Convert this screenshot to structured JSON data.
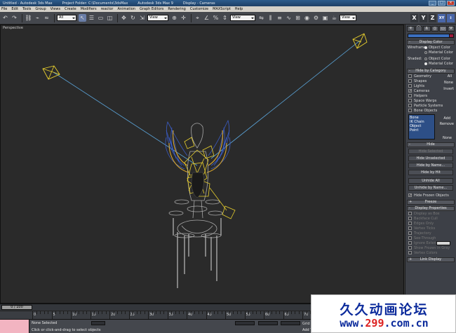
{
  "titlebar": {
    "segments": [
      "Untitled - Autodesk 3ds Max",
      "Project Folder: C:\\Documents\\3dsMax",
      "Autodesk 3ds Max 9",
      "Display - Cameras"
    ],
    "min": "_",
    "max": "□",
    "close": "×"
  },
  "menubar": [
    "File",
    "Edit",
    "Tools",
    "Group",
    "Views",
    "Create",
    "Modifiers",
    "reactor",
    "Animation",
    "Graph Editors",
    "Rendering",
    "Customize",
    "MAXScript",
    "Help"
  ],
  "toolbar": {
    "selection_filter": "All",
    "ref_coord": "View",
    "named_selection": "View",
    "axes": [
      "X",
      "Y",
      "Z",
      "XY"
    ]
  },
  "viewport": {
    "label": "Perspective",
    "colors": {
      "camera": "#e8cf2e",
      "target_line": "#5aa2d6",
      "wing_blue": "#3b5cc4",
      "wing_gold": "#d8a52a",
      "statue": "#a9a9a9"
    }
  },
  "command_panel": {
    "tabs": [
      "create-icon",
      "modify-icon",
      "hierarchy-icon",
      "motion-icon",
      "display-icon",
      "utilities-icon"
    ],
    "display_color": {
      "title": "Display Color",
      "wireframe_label": "Wireframe:",
      "shaded_label": "Shaded:",
      "object_color": "Object Color",
      "material_color": "Material Color"
    },
    "hide_by_category": {
      "title": "Hide by Category",
      "items": [
        {
          "label": "Geometry",
          "checked": false
        },
        {
          "label": "Shapes",
          "checked": false
        },
        {
          "label": "Lights",
          "checked": false
        },
        {
          "label": "Cameras",
          "checked": true
        },
        {
          "label": "Helpers",
          "checked": false
        },
        {
          "label": "Space Warps",
          "checked": false
        },
        {
          "label": "Particle Systems",
          "checked": false
        },
        {
          "label": "Bone Objects",
          "checked": false
        }
      ],
      "all": "All",
      "none": "None",
      "invert": "Invert",
      "list": [
        "Bone",
        "IK Chain Object",
        "Point"
      ],
      "add": "Add",
      "remove": "Remove",
      "none2": "None"
    },
    "hide": {
      "title": "Hide",
      "hide_selected": "Hide Selected",
      "hide_unselected": "Hide Unselected",
      "hide_by_name": "Hide by Name...",
      "hide_by_hit": "Hide by Hit",
      "unhide_all": "Unhide All",
      "unhide_by_name": "Unhide by Name...",
      "hide_frozen": "Hide Frozen Objects"
    },
    "freeze_title": "Freeze",
    "display_properties": {
      "title": "Display Properties",
      "items": [
        "Display as Box",
        "Backface Cull",
        "Edges Only",
        "Vertex Ticks",
        "Trajectory",
        "See-Through",
        "Ignore Extents",
        "Show Frozen in Gray",
        "Vertex Colors"
      ]
    },
    "link_display_title": "Link Display"
  },
  "timeline": {
    "slider": "0 / 100",
    "ticks": [
      "0",
      "5",
      "10",
      "15",
      "20",
      "25",
      "30",
      "35",
      "40",
      "45",
      "50",
      "55",
      "60",
      "65",
      "70",
      "75"
    ]
  },
  "status": {
    "selection": "None Selected",
    "prompt": "Click or click-and-drag to select objects",
    "grid": "Grid =",
    "add_time_tag": "Add Time Tag"
  },
  "watermark": {
    "title": "久久动画论坛",
    "url_prefix": "www.",
    "url_num": "299",
    "url_suffix": ".com.cn"
  }
}
